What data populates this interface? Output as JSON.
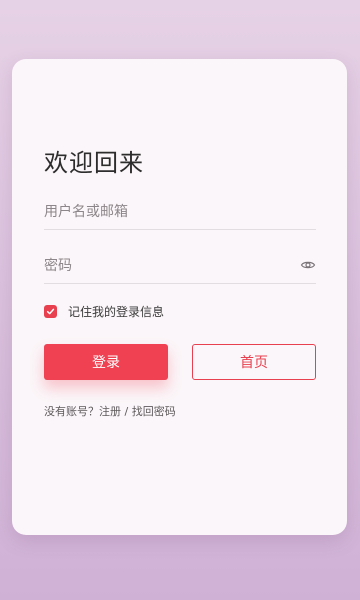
{
  "login": {
    "title": "欢迎回来",
    "username_placeholder": "用户名或邮箱",
    "username_value": "",
    "password_placeholder": "密码",
    "password_value": "",
    "show_password_icon": "eye-icon",
    "remember_label": "记住我的登录信息",
    "remember_checked": true,
    "login_button": "登录",
    "home_button": "首页",
    "footer_prefix": "没有账号？",
    "register_link": "注册",
    "separator": " / ",
    "forgot_link": "找回密码"
  },
  "colors": {
    "accent": "#ef4152",
    "card_bg": "#fbf6f9",
    "page_bg_top": "#e6d2e6",
    "page_bg_bottom": "#cfb1d6"
  }
}
